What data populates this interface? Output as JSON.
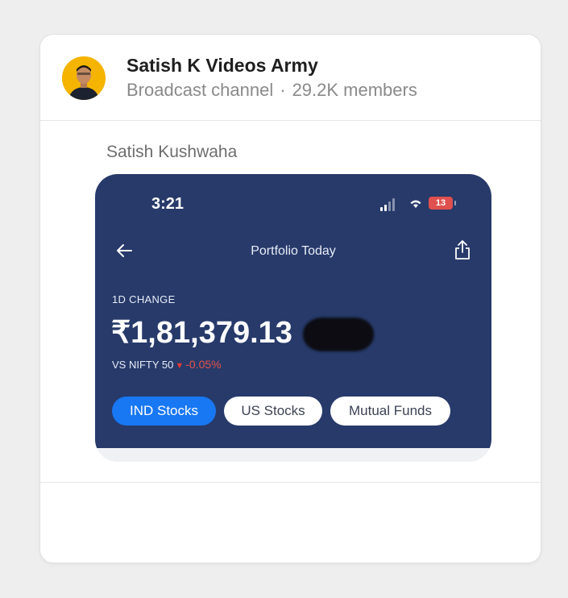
{
  "channel": {
    "name": "Satish K Videos Army",
    "type": "Broadcast channel",
    "separator": "·",
    "members": "29.2K members"
  },
  "message": {
    "sender": "Satish Kushwaha"
  },
  "screenshot": {
    "status_time": "3:21",
    "battery": "13",
    "title": "Portfolio Today",
    "change_label": "1D CHANGE",
    "change_value": "₹1,81,379.13",
    "vs_label": "VS NIFTY 50",
    "vs_change": "-0.05%",
    "chips": [
      {
        "label": "IND Stocks",
        "selected": true
      },
      {
        "label": "US Stocks",
        "selected": false
      },
      {
        "label": "Mutual Funds",
        "selected": false
      }
    ]
  },
  "colors": {
    "screen_bg": "#273a6a",
    "accent_blue": "#1877f2",
    "negative_red": "#e53935",
    "avatar_bg": "#f4b400"
  },
  "icons": [
    "avatar-photo",
    "signal-icon",
    "wifi-icon",
    "battery-icon",
    "back-arrow-icon",
    "share-icon",
    "down-triangle-icon"
  ]
}
